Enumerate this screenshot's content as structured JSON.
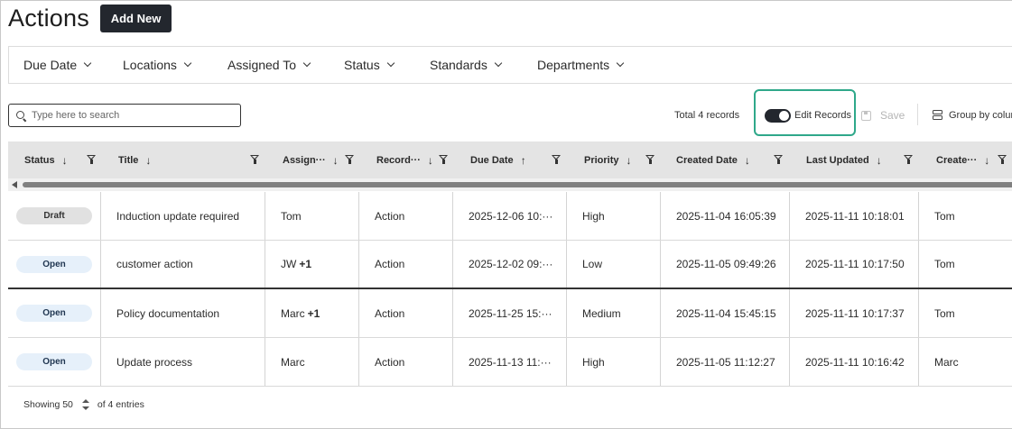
{
  "header": {
    "title": "Actions",
    "add_label": "Add New"
  },
  "filters": [
    "Due Date",
    "Locations",
    "Assigned To",
    "Status",
    "Standards",
    "Departments"
  ],
  "toolbar": {
    "search_placeholder": "Type here to search",
    "total": "Total 4 records",
    "edit_label": "Edit Records",
    "edit_on": true,
    "save_label": "Save",
    "group_label": "Group by column"
  },
  "columns": [
    {
      "label": "Status",
      "sort": "↓"
    },
    {
      "label": "Title",
      "sort": "↓"
    },
    {
      "label": "Assign···",
      "sort": "↓"
    },
    {
      "label": "Record···",
      "sort": "↓"
    },
    {
      "label": "Due Date",
      "sort": "↑"
    },
    {
      "label": "Priority",
      "sort": "↓"
    },
    {
      "label": "Created Date",
      "sort": "↓"
    },
    {
      "label": "Last Updated",
      "sort": "↓"
    },
    {
      "label": "Create···",
      "sort": "↓"
    }
  ],
  "rows": [
    {
      "status": "Draft",
      "title": "Induction update required",
      "assignee": "Tom",
      "extra": "",
      "record": "Action",
      "due": "2025-12-06 10:···",
      "priority": "High",
      "created": "2025-11-04 16:05:39",
      "updated": "2025-11-11 10:18:01",
      "creator": "Tom"
    },
    {
      "status": "Open",
      "title": "customer action",
      "assignee": "JW",
      "extra": "+1",
      "record": "Action",
      "due": "2025-12-02 09:···",
      "priority": "Low",
      "created": "2025-11-05 09:49:26",
      "updated": "2025-11-11 10:17:50",
      "creator": "Tom"
    },
    {
      "status": "Open",
      "title": "Policy documentation",
      "assignee": "Marc",
      "extra": "+1",
      "record": "Action",
      "due": "2025-11-25 15:···",
      "priority": "Medium",
      "created": "2025-11-04 15:45:15",
      "updated": "2025-11-11 10:17:37",
      "creator": "Tom"
    },
    {
      "status": "Open",
      "title": "Update process",
      "assignee": "Marc",
      "extra": "",
      "record": "Action",
      "due": "2025-11-13 11:···",
      "priority": "High",
      "created": "2025-11-05 11:12:27",
      "updated": "2025-11-11 10:16:42",
      "creator": "Marc"
    }
  ],
  "footer": {
    "showing": "Showing 50",
    "of": "of 4 entries"
  },
  "colors": {
    "accent": "#2fa88a",
    "dark": "#23272e",
    "header_bg": "#e4e4e4"
  }
}
